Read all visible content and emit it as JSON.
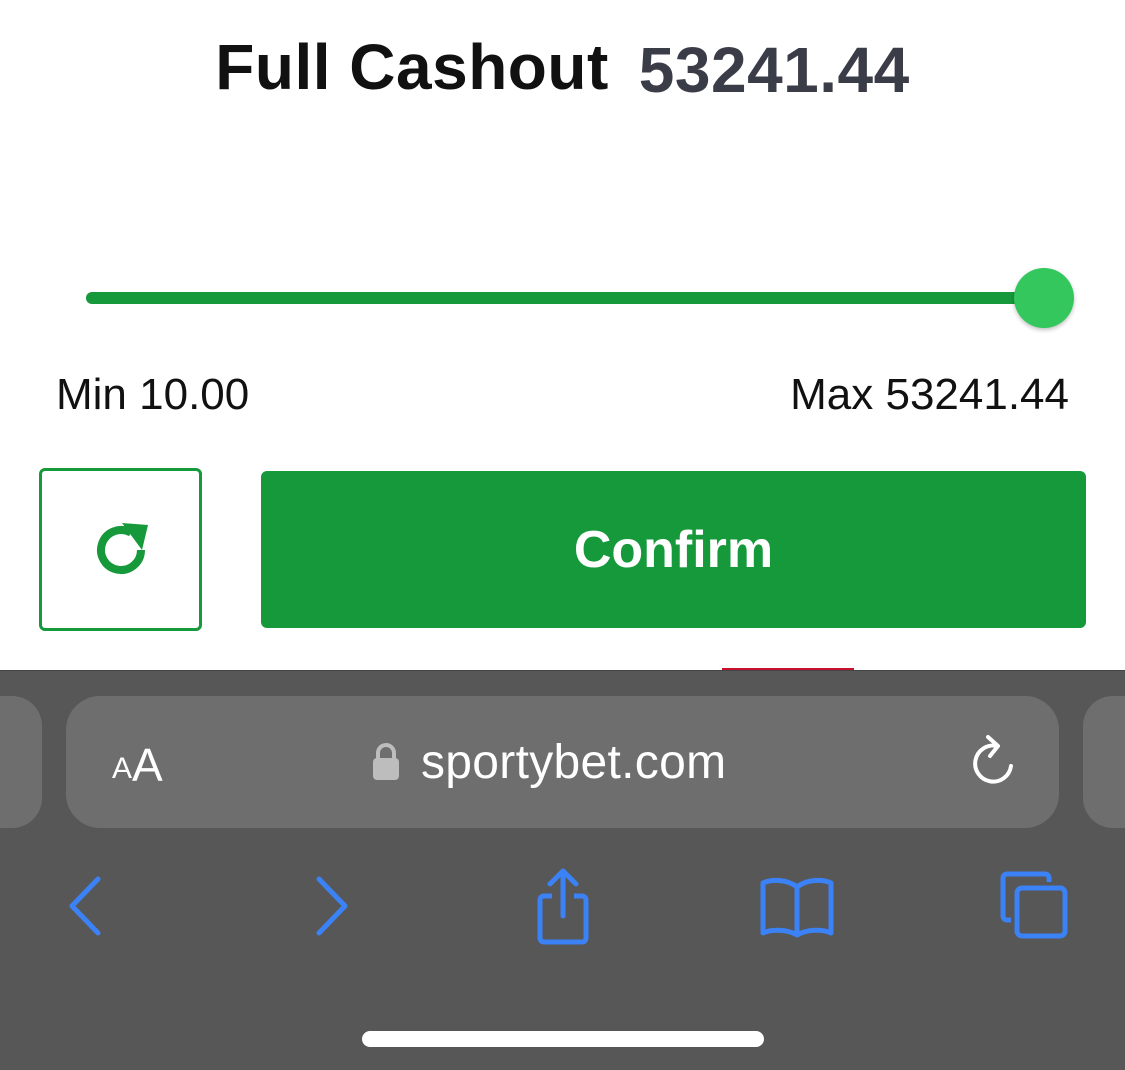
{
  "cashout": {
    "title": "Full Cashout",
    "amount": "53241.44",
    "min_label": "Min 10.00",
    "max_label": "Max 53241.44",
    "slider_fraction": 1.0,
    "confirm_label": "Confirm"
  },
  "browser": {
    "text_size_small": "A",
    "text_size_large": "A",
    "url": "sportybet.com"
  },
  "icons": {
    "refresh": "refresh-icon",
    "lock": "lock-icon",
    "reload": "reload-icon",
    "back": "chevron-left-icon",
    "forward": "chevron-right-icon",
    "share": "share-icon",
    "bookmarks": "book-icon",
    "tabs": "tabs-icon"
  },
  "colors": {
    "accent_green": "#16993b",
    "thumb_green": "#33c75d",
    "ios_blue": "#3b82f6",
    "toolbar_gray": "#575757"
  }
}
